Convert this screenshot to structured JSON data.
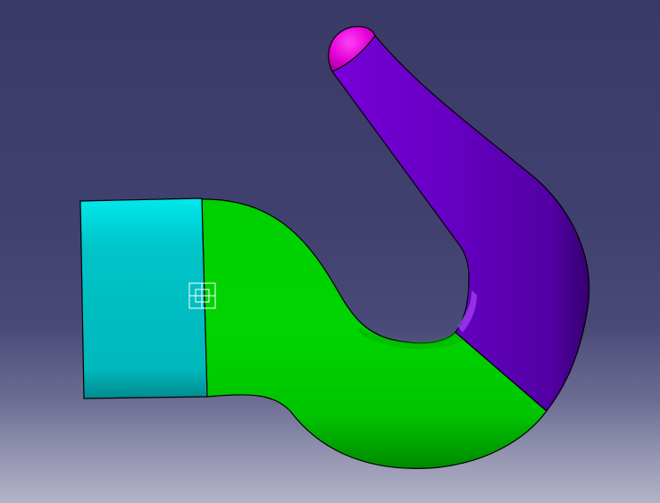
{
  "viewport": {
    "background_top": "#3a3a66",
    "background_bottom": "#b2b2c8"
  },
  "model": {
    "parts": [
      {
        "name": "shank",
        "color": "#00c8cc"
      },
      {
        "name": "s-curve",
        "color": "#00cc00"
      },
      {
        "name": "hook-bend",
        "color": "#6a00c2"
      },
      {
        "name": "tip-cap",
        "color": "#e400d8"
      }
    ],
    "edge_color": "#000000"
  },
  "compass": {
    "icon": "axis-crosshair-icon",
    "color": "#ffffff"
  }
}
